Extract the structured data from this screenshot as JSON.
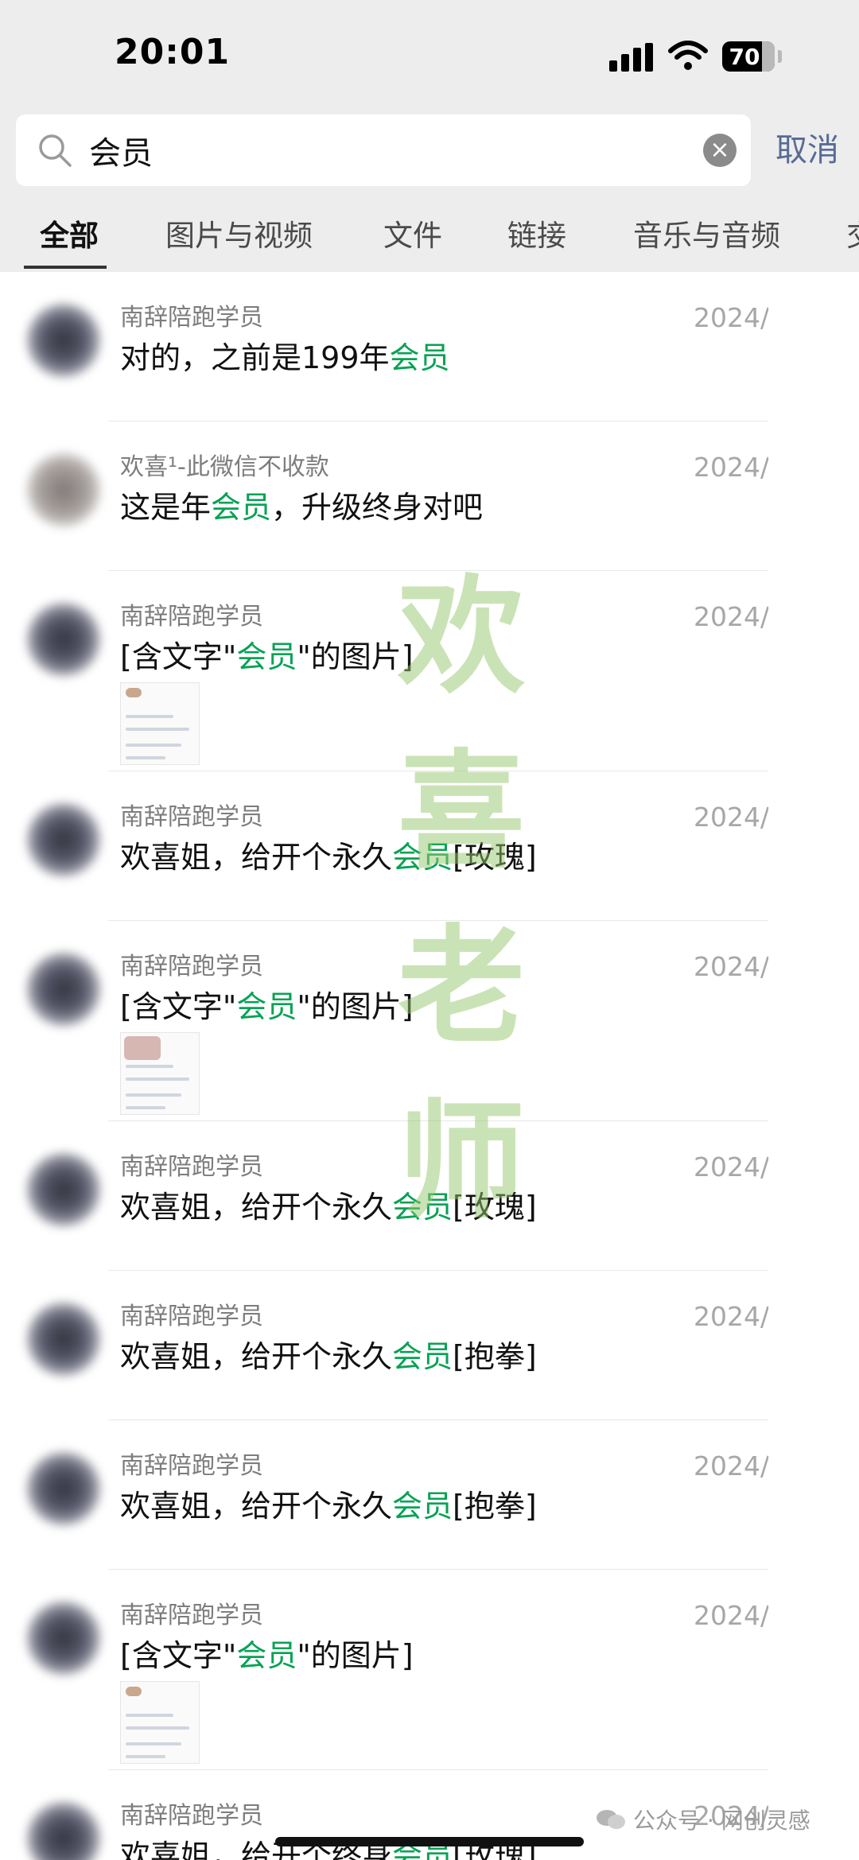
{
  "status_bar": {
    "time": "20:01",
    "battery": "70"
  },
  "search": {
    "query": "会员",
    "placeholder": "",
    "cancel_label": "取消"
  },
  "tabs": [
    {
      "label": "全部"
    },
    {
      "label": "图片与视频"
    },
    {
      "label": "文件"
    },
    {
      "label": "链接"
    },
    {
      "label": "音乐与音频"
    },
    {
      "label": "交"
    }
  ],
  "results": [
    {
      "sender": "南辞陪跑学员",
      "date": "2024/",
      "pre": "对的，之前是199年",
      "hl": "会员",
      "post": "",
      "thumb": false
    },
    {
      "sender": "欢喜¹-此微信不收款",
      "date": "2024/",
      "pre": "这是年",
      "hl": "会员",
      "post": "，升级终身对吧",
      "thumb": false
    },
    {
      "sender": "南辞陪跑学员",
      "date": "2024/",
      "pre": "[含文字\"",
      "hl": "会员",
      "post": "\"的图片]",
      "thumb": true
    },
    {
      "sender": "南辞陪跑学员",
      "date": "2024/",
      "pre": "欢喜姐，给开个永久",
      "hl": "会员",
      "post": "[玫瑰]",
      "thumb": false
    },
    {
      "sender": "南辞陪跑学员",
      "date": "2024/",
      "pre": "[含文字\"",
      "hl": "会员",
      "post": "\"的图片]",
      "thumb": true
    },
    {
      "sender": "南辞陪跑学员",
      "date": "2024/",
      "pre": "欢喜姐，给开个永久",
      "hl": "会员",
      "post": "[玫瑰]",
      "thumb": false
    },
    {
      "sender": "南辞陪跑学员",
      "date": "2024/",
      "pre": "欢喜姐，给开个永久",
      "hl": "会员",
      "post": "[抱拳]",
      "thumb": false
    },
    {
      "sender": "南辞陪跑学员",
      "date": "2024/",
      "pre": "欢喜姐，给开个永久",
      "hl": "会员",
      "post": "[抱拳]",
      "thumb": false
    },
    {
      "sender": "南辞陪跑学员",
      "date": "2024/",
      "pre": "[含文字\"",
      "hl": "会员",
      "post": "\"的图片]",
      "thumb": true
    },
    {
      "sender": "南辞陪跑学员",
      "date": "2024/",
      "pre": "欢喜姐，给开个终身",
      "hl": "会员",
      "post": "[玫瑰]",
      "thumb": false
    }
  ],
  "watermark": {
    "chars": [
      "欢",
      "喜",
      "老",
      "师"
    ]
  },
  "footer": {
    "text": "公众号 · 网创灵感"
  },
  "colors": {
    "highlight": "#07a254",
    "cancel": "#576b95",
    "background_top": "#ededed"
  },
  "icons": [
    "search-icon",
    "clear-icon",
    "signal-icon",
    "wifi-icon",
    "battery-icon",
    "wechat-icon"
  ]
}
